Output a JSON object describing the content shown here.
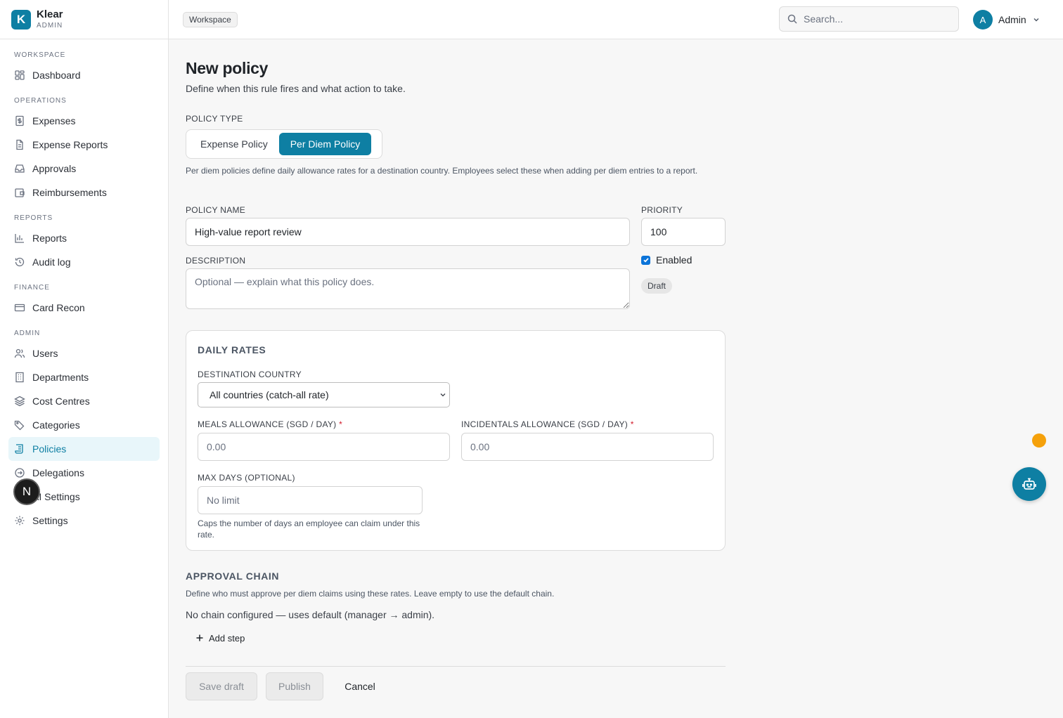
{
  "brand": {
    "logo_letter": "K",
    "name": "Klear",
    "sub": "ADMIN"
  },
  "sidebar": {
    "sections": [
      {
        "title": "WORKSPACE",
        "items": [
          {
            "label": "Dashboard",
            "icon": "dashboard-icon"
          }
        ]
      },
      {
        "title": "OPERATIONS",
        "items": [
          {
            "label": "Expenses",
            "icon": "receipt-icon"
          },
          {
            "label": "Expense Reports",
            "icon": "document-icon"
          },
          {
            "label": "Approvals",
            "icon": "inbox-icon"
          },
          {
            "label": "Reimbursements",
            "icon": "wallet-icon"
          }
        ]
      },
      {
        "title": "REPORTS",
        "items": [
          {
            "label": "Reports",
            "icon": "bar-chart-icon"
          },
          {
            "label": "Audit log",
            "icon": "history-icon"
          }
        ]
      },
      {
        "title": "FINANCE",
        "items": [
          {
            "label": "Card Recon",
            "icon": "credit-card-icon"
          }
        ]
      },
      {
        "title": "ADMIN",
        "items": [
          {
            "label": "Users",
            "icon": "users-icon"
          },
          {
            "label": "Departments",
            "icon": "building-icon"
          },
          {
            "label": "Cost Centres",
            "icon": "layers-icon"
          },
          {
            "label": "Categories",
            "icon": "tags-icon"
          },
          {
            "label": "Policies",
            "icon": "scroll-icon",
            "active": true
          },
          {
            "label": "Delegations",
            "icon": "delegation-icon"
          },
          {
            "label": "AI Settings",
            "icon": "brain-icon"
          },
          {
            "label": "Settings",
            "icon": "gear-icon"
          }
        ]
      }
    ],
    "next_badge": "N"
  },
  "topbar": {
    "breadcrumb": "Workspace",
    "search_placeholder": "Search...",
    "user": {
      "initial": "A",
      "name": "Admin"
    }
  },
  "form": {
    "title": "New policy",
    "subtitle": "Define when this rule fires and what action to take.",
    "policy_type_label": "POLICY TYPE",
    "policy_types": [
      "Expense Policy",
      "Per Diem Policy"
    ],
    "selected_policy_type": "Per Diem Policy",
    "policy_type_hint": "Per diem policies define daily allowance rates for a destination country. Employees select these when adding per diem entries to a report.",
    "name_label": "POLICY NAME",
    "name_value": "High-value report review",
    "priority_label": "PRIORITY",
    "priority_value": "100",
    "description_label": "DESCRIPTION",
    "description_placeholder": "Optional — explain what this policy does.",
    "enabled_label": "Enabled",
    "enabled": true,
    "status_badge": "Draft",
    "daily_rates": {
      "title": "DAILY RATES",
      "country_label": "DESTINATION COUNTRY",
      "country_value": "All countries (catch-all rate)",
      "meals_label": "MEALS ALLOWANCE (SGD / DAY)",
      "meals_placeholder": "0.00",
      "incidentals_label": "INCIDENTALS ALLOWANCE (SGD / DAY)",
      "incidentals_placeholder": "0.00",
      "required_mark": "*",
      "max_days_label": "MAX DAYS (OPTIONAL)",
      "max_days_placeholder": "No limit",
      "max_days_hint": "Caps the number of days an employee can claim under this rate."
    },
    "approval_chain": {
      "title": "APPROVAL CHAIN",
      "hint": "Define who must approve per diem claims using these rates. Leave empty to use the default chain.",
      "empty_text": "No chain configured — uses default (manager → admin).",
      "add_step_label": "Add step"
    },
    "actions": {
      "save_draft": "Save draft",
      "publish": "Publish",
      "cancel": "Cancel"
    }
  },
  "colors": {
    "accent": "#0e7fa3",
    "notification_dot": "#f5a10b"
  }
}
